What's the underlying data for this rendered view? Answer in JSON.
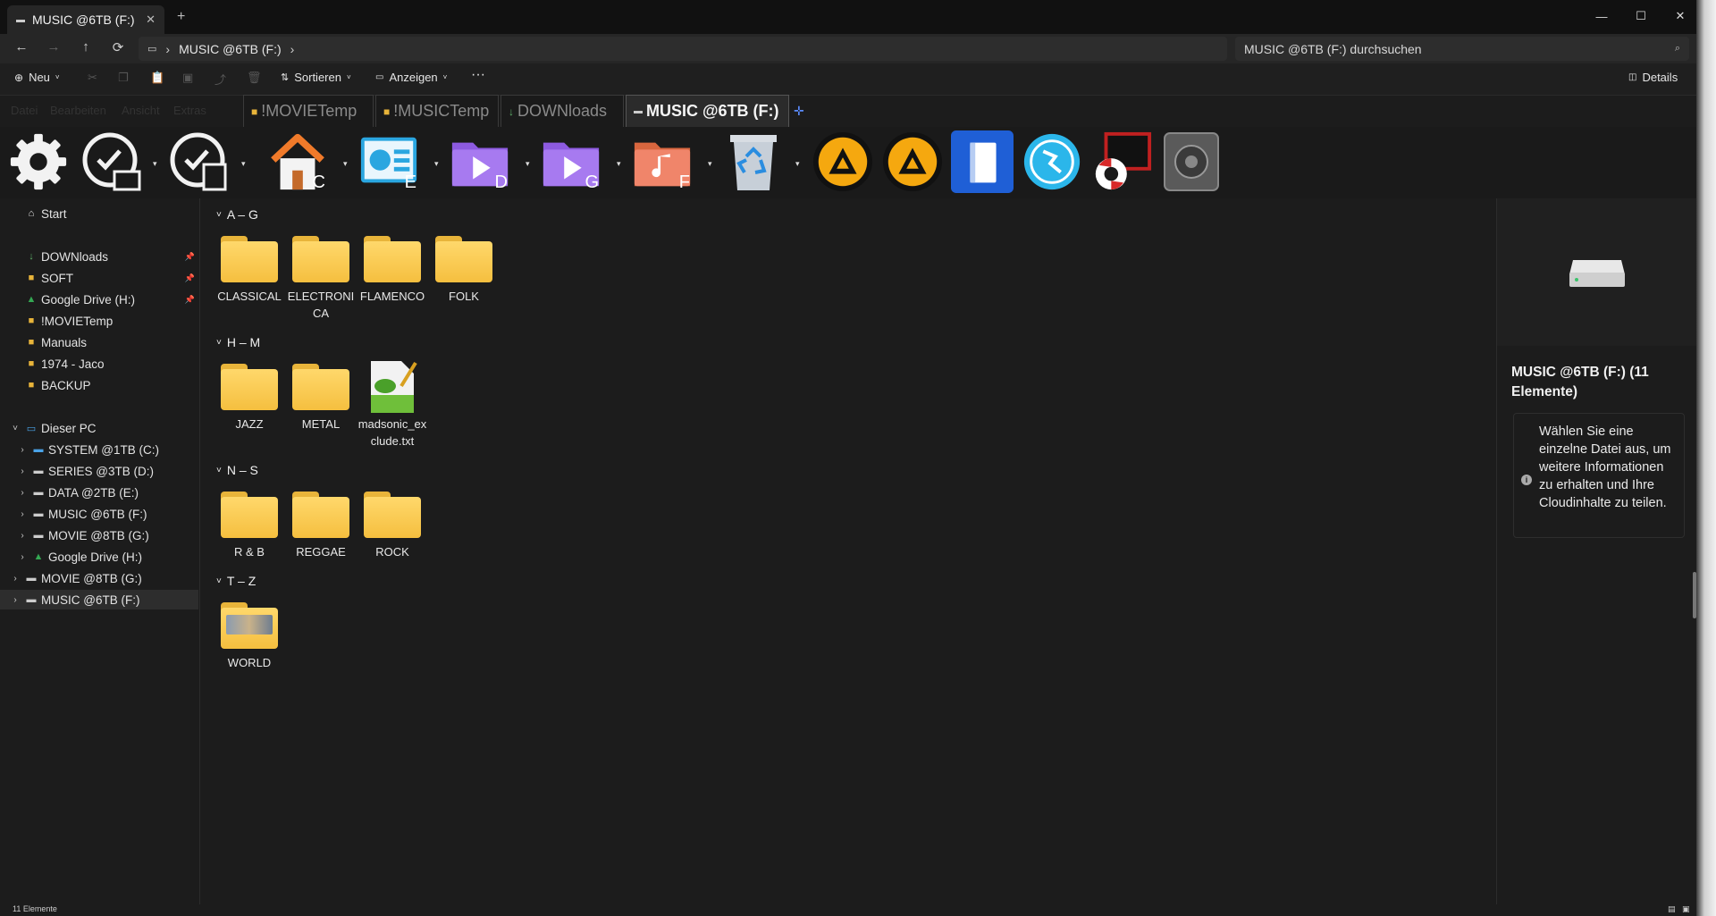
{
  "window": {
    "tab_title": "MUSIC @6TB (F:)",
    "new_tab": "+",
    "close_tab": "✕",
    "minimize": "—",
    "maximize": "☐",
    "close": "✕"
  },
  "nav": {
    "back": "←",
    "forward": "→",
    "up": "↑",
    "refresh": "⟳",
    "address": "MUSIC @6TB (F:)",
    "search_placeholder": "MUSIC @6TB (F:) durchsuchen"
  },
  "commandbar": {
    "new": "Neu",
    "sort": "Sortieren",
    "view": "Anzeigen",
    "more": "···",
    "details": "Details"
  },
  "menu": [
    "Datei",
    "Bearbeiten",
    "Ansicht",
    "Extras"
  ],
  "explorer_tabs": [
    {
      "label": "!MOVIETemp"
    },
    {
      "label": "!MUSICTemp"
    },
    {
      "label": "DOWNloads"
    },
    {
      "label": "MUSIC @6TB (F:)"
    }
  ],
  "launcher": {
    "drive_letters": [
      "C",
      "E",
      "D",
      "G",
      "F"
    ]
  },
  "sidebar": {
    "home": "Start",
    "quick": [
      {
        "label": "DOWNloads",
        "pinned": true
      },
      {
        "label": "SOFT",
        "pinned": true
      },
      {
        "label": "Google Drive (H:)",
        "pinned": true
      },
      {
        "label": "!MOVIETemp",
        "pinned": false
      },
      {
        "label": "Manuals",
        "pinned": false
      },
      {
        "label": "1974 - Jaco",
        "pinned": false
      },
      {
        "label": "BACKUP",
        "pinned": false
      }
    ],
    "this_pc": "Dieser PC",
    "drives": [
      "SYSTEM @1TB (C:)",
      "SERIES @3TB (D:)",
      "DATA @2TB (E:)",
      "MUSIC @6TB (F:)",
      "MOVIE @8TB (G:)",
      "Google Drive (H:)"
    ],
    "extra": [
      "MOVIE @8TB (G:)",
      "MUSIC @6TB (F:)"
    ]
  },
  "content": {
    "groups": [
      {
        "label": "A – G",
        "items": [
          "CLASSICAL",
          "ELECTRONICA",
          "FLAMENCO",
          "FOLK"
        ]
      },
      {
        "label": "H – M",
        "items": [
          "JAZZ",
          "METAL",
          "madsonic_exclude.txt"
        ]
      },
      {
        "label": "N – S",
        "items": [
          "R & B",
          "REGGAE",
          "ROCK"
        ]
      },
      {
        "label": "T – Z",
        "items": [
          "WORLD"
        ]
      }
    ]
  },
  "details_pane": {
    "title": "MUSIC @6TB (F:) (11 Elemente)",
    "info": "Wählen Sie eine einzelne Datei aus, um weitere Informationen zu erhalten und Ihre Cloudinhalte zu teilen."
  },
  "status": {
    "count": "11 Elemente"
  }
}
